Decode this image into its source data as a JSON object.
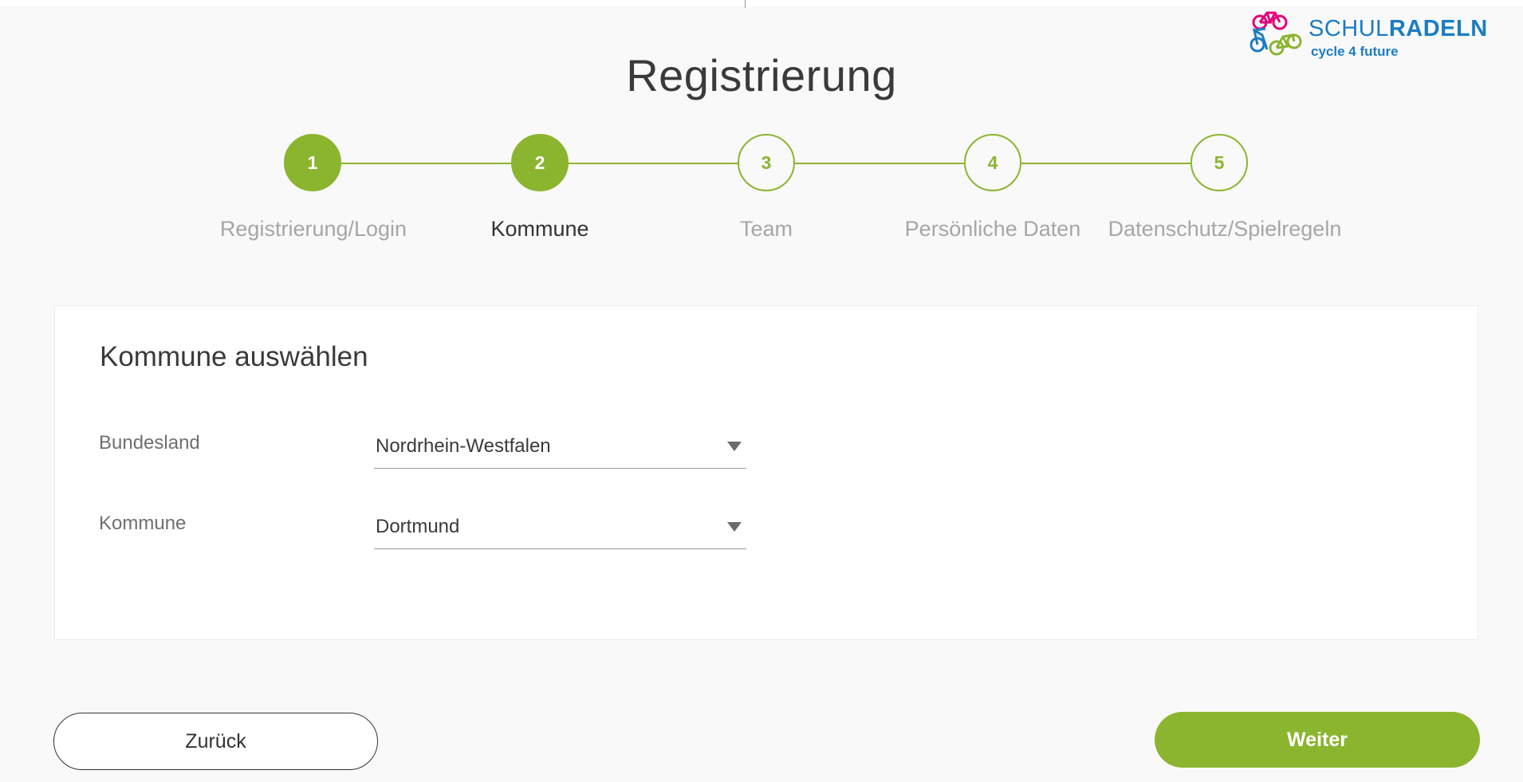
{
  "logo": {
    "title_light": "SCHUL",
    "title_bold": "RADELN",
    "tagline": "cycle 4 future",
    "colors": {
      "pink": "#e2007a",
      "blue": "#1b7dc3",
      "green": "#8bb52f"
    }
  },
  "page_title": "Registrierung",
  "stepper": {
    "accent": "#8bb52f",
    "current_step": 2,
    "steps": [
      {
        "number": "1",
        "label": "Registrierung/Login",
        "state": "completed"
      },
      {
        "number": "2",
        "label": "Kommune",
        "state": "active"
      },
      {
        "number": "3",
        "label": "Team",
        "state": "pending"
      },
      {
        "number": "4",
        "label": "Persönliche Daten",
        "state": "pending"
      },
      {
        "number": "5",
        "label": "Datenschutz/Spielregeln",
        "state": "pending"
      }
    ]
  },
  "form": {
    "title": "Kommune auswählen",
    "fields": [
      {
        "label": "Bundesland",
        "value": "Nordrhein-Westfalen",
        "icon": "caret-down-icon"
      },
      {
        "label": "Kommune",
        "value": "Dortmund",
        "icon": "caret-down-icon"
      }
    ]
  },
  "buttons": {
    "back_label": "Zurück",
    "next_label": "Weiter"
  }
}
